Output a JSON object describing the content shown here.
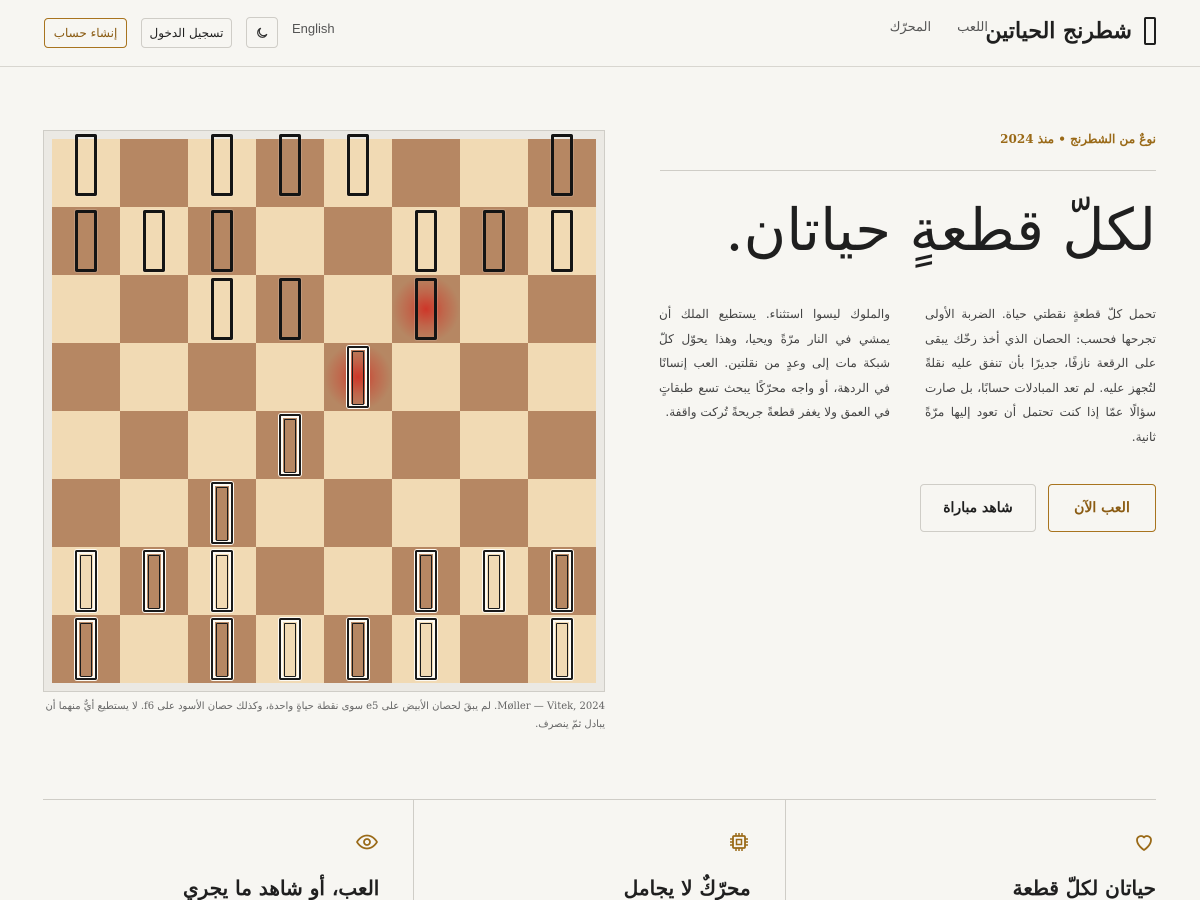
{
  "header": {
    "brand": "شطرنج الحياتين",
    "nav": [
      "اللعب",
      "المحرّك"
    ],
    "language": "English",
    "theme_icon": "moon-icon",
    "login_label": "تسجيل الدخول",
    "signup_label": "إنشاء حساب"
  },
  "board": {
    "pieces": [
      {
        "sq": "a8",
        "color": "black"
      },
      {
        "sq": "c8",
        "color": "black"
      },
      {
        "sq": "d8",
        "color": "black"
      },
      {
        "sq": "e8",
        "color": "black"
      },
      {
        "sq": "h8",
        "color": "black"
      },
      {
        "sq": "a7",
        "color": "black"
      },
      {
        "sq": "b7",
        "color": "black"
      },
      {
        "sq": "c7",
        "color": "black"
      },
      {
        "sq": "f7",
        "color": "black"
      },
      {
        "sq": "g7",
        "color": "black"
      },
      {
        "sq": "h7",
        "color": "black"
      },
      {
        "sq": "c6",
        "color": "black"
      },
      {
        "sq": "d6",
        "color": "black"
      },
      {
        "sq": "f6",
        "color": "black",
        "wounded": true
      },
      {
        "sq": "e5",
        "color": "white",
        "wounded": true
      },
      {
        "sq": "d4",
        "color": "white"
      },
      {
        "sq": "c3",
        "color": "white"
      },
      {
        "sq": "a2",
        "color": "white"
      },
      {
        "sq": "b2",
        "color": "white"
      },
      {
        "sq": "c2",
        "color": "white"
      },
      {
        "sq": "f2",
        "color": "white"
      },
      {
        "sq": "g2",
        "color": "white"
      },
      {
        "sq": "h2",
        "color": "white"
      },
      {
        "sq": "a1",
        "color": "white"
      },
      {
        "sq": "c1",
        "color": "white"
      },
      {
        "sq": "d1",
        "color": "white"
      },
      {
        "sq": "e1",
        "color": "white"
      },
      {
        "sq": "f1",
        "color": "white"
      },
      {
        "sq": "h1",
        "color": "white"
      }
    ],
    "caption": "Møller — Vitek, 2024. لم يبقَ لحصان الأبيض على e5 سوى نقطة حياةٍ واحدة، وكذلك حصان الأسود على f6. لا يستطيع أيٌّ منهما أن يبادل ثمّ ينصرف."
  },
  "hero": {
    "kicker": "نوعٌ من الشطرنج • منذ 2024",
    "title": "لكلّ قطعةٍ حياتان.",
    "paragraph_1": "تحمل كلّ قطعةٍ نقطتي حياة. الضربة الأولى تجرحها فحسب: الحصان الذي أخذ رخّك يبقى على الرقعة نازفًا، جديرًا بأن تنفق عليه نقلةً لتُجهز عليه. لم تعد المبادلات حسابًا، بل صارت سؤالًا عمّا إذا كنت تحتمل أن تعود إليها مرّةً ثانية.",
    "paragraph_2": "والملوك ليسوا استثناء. يستطيع الملك أن يمشي في النار مرّةً ويحيا، وهذا يحوّل كلّ شبكة مات إلى وعدٍ من نقلتين. العب إنسانًا في الردهة، أو واجه محرّكًا يبحث تسع طبقاتٍ في العمق ولا يغفر قطعةً جريحةً تُركت واقفة.",
    "play_label": "العب الآن",
    "watch_label": "شاهد مباراة"
  },
  "features": [
    {
      "icon": "heart-icon",
      "title": "حياتان لكلّ قطعة"
    },
    {
      "icon": "cpu-chip-icon",
      "title": "محرّكٌ لا يجامل"
    },
    {
      "icon": "eye-icon",
      "title": "العب، أو شاهد ما يجري"
    }
  ],
  "colors": {
    "accent": "#9a6a18",
    "light_square": "#f1dab4",
    "dark_square": "#b68763",
    "wound_glow": "#d2281e"
  }
}
